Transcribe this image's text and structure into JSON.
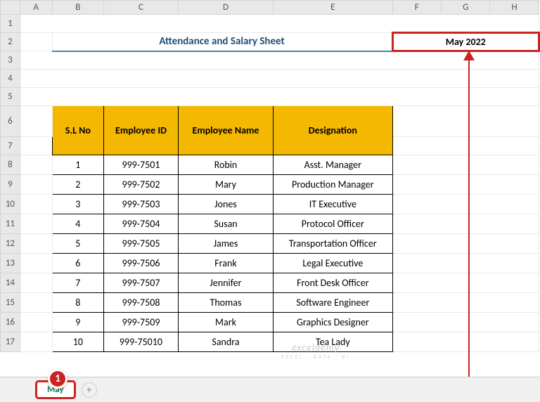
{
  "columns": [
    "",
    "A",
    "B",
    "C",
    "D",
    "E",
    "F",
    "G",
    "H"
  ],
  "row_numbers": [
    "1",
    "2",
    "3",
    "4",
    "5",
    "6",
    "7",
    "8",
    "9",
    "10",
    "11",
    "12",
    "13",
    "14",
    "15",
    "16",
    "17"
  ],
  "title": "Attendance and Salary Sheet",
  "date_label": "May 2022",
  "headers": {
    "sl": "S.L No",
    "empid": "Employee ID",
    "name": "Employee Name",
    "desig": "Designation"
  },
  "rows": [
    {
      "sl": "1",
      "id": "999-7501",
      "name": "Robin",
      "desig": "Asst. Manager"
    },
    {
      "sl": "2",
      "id": "999-7502",
      "name": "Mary",
      "desig": "Production Manager"
    },
    {
      "sl": "3",
      "id": "999-7503",
      "name": "Jones",
      "desig": "IT Executive"
    },
    {
      "sl": "4",
      "id": "999-7504",
      "name": "Susan",
      "desig": "Protocol Officer"
    },
    {
      "sl": "5",
      "id": "999-7505",
      "name": "James",
      "desig": "Transportation Officer"
    },
    {
      "sl": "6",
      "id": "999-7506",
      "name": "Frank",
      "desig": "Legal Executive"
    },
    {
      "sl": "7",
      "id": "999-7507",
      "name": "Jennifer",
      "desig": "Front Desk Officer"
    },
    {
      "sl": "8",
      "id": "999-7508",
      "name": "Thomas",
      "desig": "Software Engineer"
    },
    {
      "sl": "9",
      "id": "999-7509",
      "name": "Mark",
      "desig": "Graphics Designer"
    },
    {
      "sl": "10",
      "id": "999-75010",
      "name": "Sandra",
      "desig": "Tea Lady"
    }
  ],
  "tab": {
    "name": "May"
  },
  "step": "1",
  "watermark": {
    "brand": "exceldemy",
    "sub": "EXCEL · DATA · BI"
  },
  "new_sheet_glyph": "+"
}
